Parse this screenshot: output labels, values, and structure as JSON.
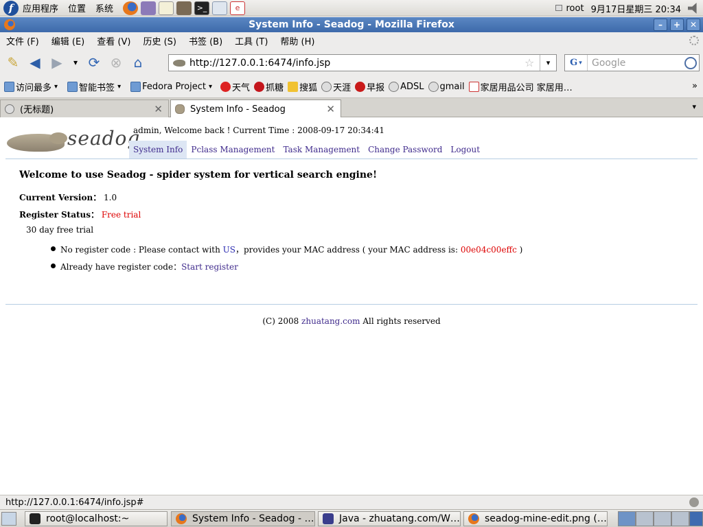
{
  "panel": {
    "menu": [
      "应用程序",
      "位置",
      "系统"
    ],
    "launchers": [
      "firefox-icon",
      "pidgin-icon",
      "text-editor-icon",
      "gimp-icon",
      "terminal-icon",
      "rdesktop-icon",
      "e-icon"
    ],
    "user": "root",
    "datetime": "9月17日星期三 20:34"
  },
  "window": {
    "title": "System Info - Seadog - Mozilla Firefox"
  },
  "menubar": {
    "items": [
      "文件 (F)",
      "编辑 (E)",
      "查看 (V)",
      "历史 (S)",
      "书签 (B)",
      "工具 (T)",
      "帮助 (H)"
    ]
  },
  "navbar": {
    "url": "http://127.0.0.1:6474/info.jsp",
    "search_placeholder": "Google",
    "search_engine": "G"
  },
  "bookmarks": {
    "items": [
      {
        "label": "访问最多",
        "icon": "folder-icon",
        "has_caret": true
      },
      {
        "label": "智能书签",
        "icon": "folder-icon",
        "has_caret": true
      },
      {
        "label": "Fedora Project",
        "icon": "folder-icon",
        "has_caret": true
      },
      {
        "label": "天气",
        "icon": "weather-icon",
        "has_caret": false
      },
      {
        "label": "抓糖",
        "icon": "zhuatang-icon",
        "has_caret": false
      },
      {
        "label": "搜狐",
        "icon": "sohu-icon",
        "has_caret": false
      },
      {
        "label": "天涯",
        "icon": "tianya-icon",
        "has_caret": false
      },
      {
        "label": "早报",
        "icon": "zaobao-icon",
        "has_caret": false
      },
      {
        "label": "ADSL",
        "icon": "adsl-icon",
        "has_caret": false
      },
      {
        "label": "gmail",
        "icon": "gmail-icon",
        "has_caret": false
      },
      {
        "label": "家居用品公司 家居用…",
        "icon": "home-goods-icon",
        "has_caret": false
      }
    ],
    "overflow": "»"
  },
  "tabs": [
    {
      "label": "(无标题)",
      "active": false
    },
    {
      "label": "System Info - Seadog",
      "active": true
    }
  ],
  "page": {
    "logo_text": "seadog",
    "welcome": "admin, Welcome back ! Current Time : 2008-09-17 20:34:41",
    "nav": [
      "System Info",
      "Pclass Management",
      "Task Management",
      "Change Password",
      "Logout"
    ],
    "headline": "Welcome to use Seadog - spider system for vertical search engine!",
    "version_label": "Current Version：",
    "version_value": "1.0",
    "register_label": "Register Status：",
    "register_value": "Free trial",
    "trial_text": "30 day free trial",
    "bullet1": {
      "prefix": "No register code : Please contact with ",
      "link": "US",
      "middle": "，provides your MAC address ( your MAC address is: ",
      "mac": "00e04c00effc",
      "suffix": " )"
    },
    "bullet2": {
      "prefix": "Already have register code：",
      "link": "Start register"
    },
    "footer": {
      "prefix": "(C) 2008 ",
      "link": "zhuatang.com",
      "suffix": " All rights reserved"
    }
  },
  "status": {
    "text": "http://127.0.0.1:6474/info.jsp#"
  },
  "taskbar": {
    "tasks": [
      {
        "label": "root@localhost:~",
        "icon": "terminal-icon"
      },
      {
        "label": "System Info - Seadog - …",
        "icon": "firefox-icon"
      },
      {
        "label": "Java - zhuatang.com/W…",
        "icon": "eclipse-icon"
      },
      {
        "label": "seadog-mine-edit.png (…",
        "icon": "firefox-icon"
      }
    ]
  },
  "colors": {
    "titlebar": "#3d6aaa",
    "link": "#3f2a8c",
    "red_value": "#dd0000",
    "rule": "#b6cde3"
  }
}
